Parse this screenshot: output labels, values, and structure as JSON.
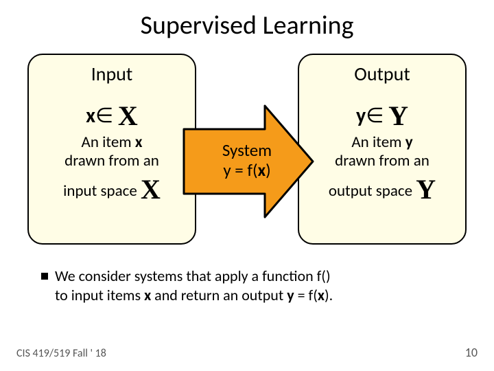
{
  "title": "Supervised Learning",
  "input_box": {
    "heading": "Input",
    "expr_var": "x",
    "member": "∈ ",
    "space": "X",
    "line1": "An item ",
    "line1_b": "x",
    "line2": "drawn from an",
    "line3_a": "input space ",
    "line3_space": "X"
  },
  "output_box": {
    "heading": "Output",
    "expr_var": "y",
    "member": "∈ ",
    "space": "Y",
    "line1": "An item ",
    "line1_b": "y",
    "line2": "drawn from an",
    "line3_a": "output space ",
    "line3_space": "Y"
  },
  "arrow": {
    "l1": "System",
    "l2a": "y = f(",
    "l2b": "x",
    "l2c": ")"
  },
  "bullet": {
    "t1": "We consider systems that apply a function f()",
    "t2a": "to input items ",
    "t2b": "x",
    "t2c": " and return an output ",
    "t2d": "y",
    "t2e": " = f(",
    "t2f": "x",
    "t2g": ")."
  },
  "footer": {
    "left": "CIS 419/519 Fall ' 18",
    "right": "10"
  }
}
